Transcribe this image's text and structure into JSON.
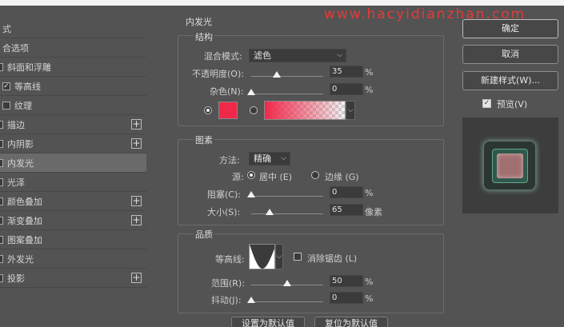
{
  "watermark": "www.hacyidianzhan.com",
  "left_panel": {
    "items": [
      {
        "label": "式",
        "checkbox": null,
        "plus": false,
        "selected": false
      },
      {
        "label": "合选项",
        "checkbox": null,
        "plus": false,
        "selected": false
      },
      {
        "label": "斜面和浮雕",
        "checkbox": "partial",
        "plus": false,
        "selected": false
      },
      {
        "label": "等高线",
        "checkbox": "checked",
        "plus": false,
        "selected": false
      },
      {
        "label": "纹理",
        "checkbox": "unchecked",
        "plus": false,
        "selected": false
      },
      {
        "label": "描边",
        "checkbox": "partial",
        "plus": true,
        "selected": false
      },
      {
        "label": "内阴影",
        "checkbox": "partial",
        "plus": true,
        "selected": false
      },
      {
        "label": "内发光",
        "checkbox": "partial",
        "plus": false,
        "selected": true
      },
      {
        "label": "光泽",
        "checkbox": "partial",
        "plus": false,
        "selected": false
      },
      {
        "label": "颜色叠加",
        "checkbox": "partial",
        "plus": true,
        "selected": false
      },
      {
        "label": "渐变叠加",
        "checkbox": "partial",
        "plus": true,
        "selected": false
      },
      {
        "label": "图案叠加",
        "checkbox": "partial",
        "plus": false,
        "selected": false
      },
      {
        "label": "外发光",
        "checkbox": "partial",
        "plus": false,
        "selected": false
      },
      {
        "label": "投影",
        "checkbox": "partial",
        "plus": true,
        "selected": false
      }
    ],
    "plus_symbol": "+",
    "check_symbol": "✓"
  },
  "main": {
    "section_title": "内发光",
    "structure": {
      "title": "结构",
      "blend_mode_label": "混合模式:",
      "blend_mode_value": "滤色",
      "opacity_label": "不透明度(O):",
      "opacity_value": 35,
      "opacity_display": "35",
      "noise_label": "杂色(N):",
      "noise_value": 0,
      "noise_display": "0",
      "percent": "%",
      "glow_color": "#f0284a"
    },
    "elements": {
      "title": "图素",
      "method_label": "方法:",
      "method_value": "精确",
      "source_label": "源:",
      "source_center": "居中 (E)",
      "source_edge": "边缘 (G)",
      "choke_label": "阻塞(C):",
      "choke_value": 0,
      "choke_display": "0",
      "size_label": "大小(S):",
      "size_value": 65,
      "size_display": "65",
      "size_unit": "像素",
      "percent": "%"
    },
    "quality": {
      "title": "品质",
      "contour_label": "等高线:",
      "antialias_label": "消除锯齿 (L)",
      "range_label": "范围(R):",
      "range_value": 50,
      "range_display": "50",
      "jitter_label": "抖动(J):",
      "jitter_value": 0,
      "jitter_display": "0",
      "percent": "%"
    },
    "bottom_buttons": {
      "set_default": "设置为默认值",
      "reset_default": "复位为默认值"
    }
  },
  "right_panel": {
    "ok": "确定",
    "cancel": "取消",
    "new_style": "新建样式(W)...",
    "preview_label": "预览(V)",
    "preview_checked": true
  }
}
